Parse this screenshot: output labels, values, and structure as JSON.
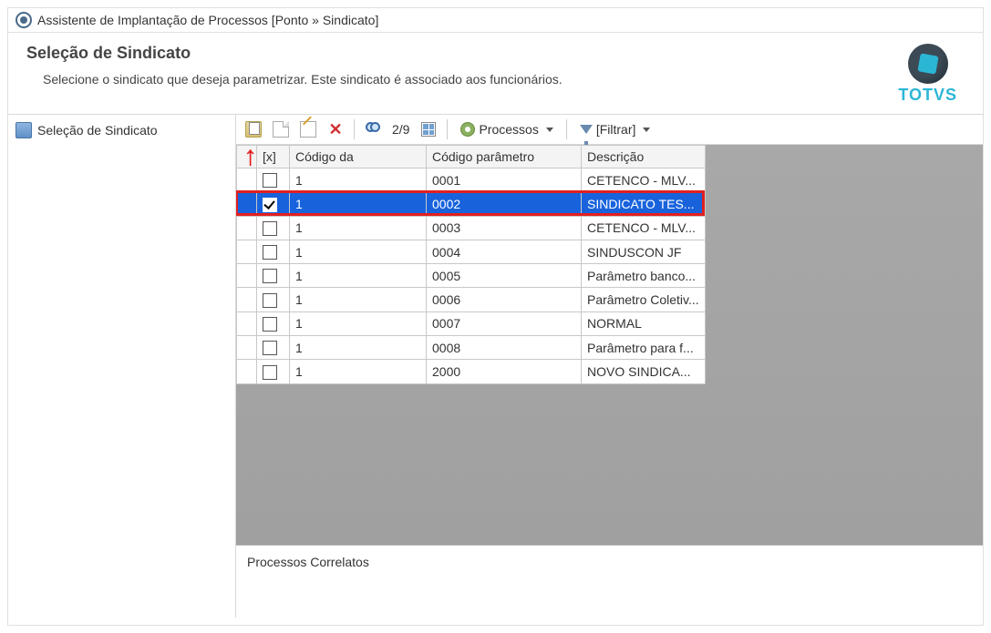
{
  "window": {
    "title": "Assistente de Implantação de Processos [Ponto » Sindicato]"
  },
  "header": {
    "title": "Seleção de Sindicato",
    "subtitle": "Selecione o sindicato que deseja parametrizar. Este sindicato é associado aos funcionários."
  },
  "brand": {
    "name": "TOTVS"
  },
  "sidebar": {
    "items": [
      {
        "label": "Seleção de Sindicato"
      }
    ]
  },
  "toolbar": {
    "counter": "2/9",
    "processes_label": "Processos",
    "filter_label": "[Filtrar]"
  },
  "grid": {
    "headers": {
      "mark": "",
      "check": "[x]",
      "codigo": "Código da",
      "parametro": "Código parâmetro",
      "descricao": "Descrição"
    },
    "rows": [
      {
        "checked": false,
        "codigo": "1",
        "parametro": "0001",
        "descricao": "CETENCO - MLV...",
        "selected": false
      },
      {
        "checked": true,
        "codigo": "1",
        "parametro": "0002",
        "descricao": "SINDICATO TES...",
        "selected": true,
        "highlight": true
      },
      {
        "checked": false,
        "codigo": "1",
        "parametro": "0003",
        "descricao": "CETENCO - MLV...",
        "selected": false
      },
      {
        "checked": false,
        "codigo": "1",
        "parametro": "0004",
        "descricao": "SINDUSCON JF",
        "selected": false
      },
      {
        "checked": false,
        "codigo": "1",
        "parametro": "0005",
        "descricao": "Parâmetro banco...",
        "selected": false
      },
      {
        "checked": false,
        "codigo": "1",
        "parametro": "0006",
        "descricao": "Parâmetro Coletiv...",
        "selected": false
      },
      {
        "checked": false,
        "codigo": "1",
        "parametro": "0007",
        "descricao": "NORMAL",
        "selected": false
      },
      {
        "checked": false,
        "codigo": "1",
        "parametro": "0008",
        "descricao": "Parâmetro para f...",
        "selected": false
      },
      {
        "checked": false,
        "codigo": "1",
        "parametro": "2000",
        "descricao": "NOVO SINDICA...",
        "selected": false
      }
    ]
  },
  "bottom_panel": {
    "title": "Processos Correlatos"
  }
}
